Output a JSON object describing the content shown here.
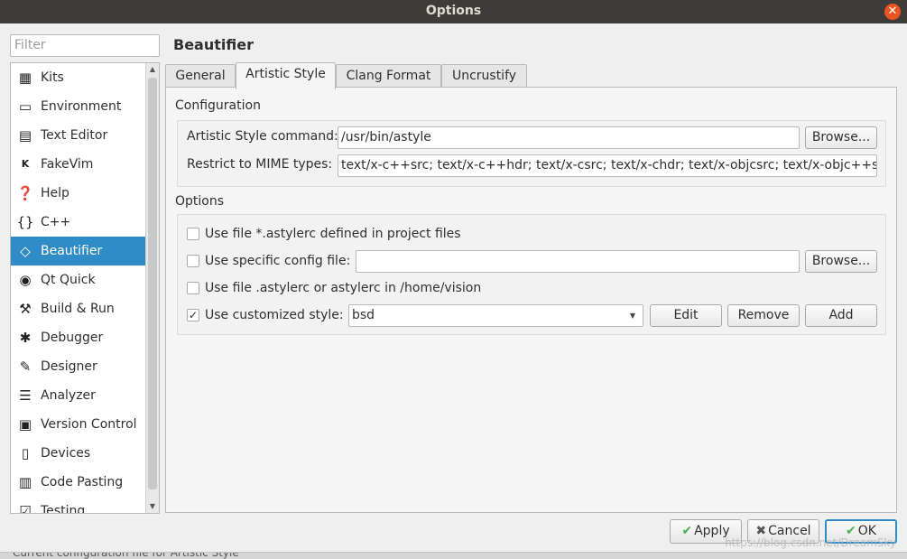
{
  "window": {
    "title": "Options"
  },
  "filter": {
    "placeholder": "Filter"
  },
  "categories": [
    {
      "label": "Kits",
      "icon": "kits-icon"
    },
    {
      "label": "Environment",
      "icon": "monitor-icon"
    },
    {
      "label": "Text Editor",
      "icon": "text-editor-icon"
    },
    {
      "label": "FakeVim",
      "icon": "fakevim-icon"
    },
    {
      "label": "Help",
      "icon": "help-icon"
    },
    {
      "label": "C++",
      "icon": "braces-icon"
    },
    {
      "label": "Beautifier",
      "icon": "diamond-icon"
    },
    {
      "label": "Qt Quick",
      "icon": "qtquick-icon"
    },
    {
      "label": "Build & Run",
      "icon": "hammer-icon"
    },
    {
      "label": "Debugger",
      "icon": "bug-icon"
    },
    {
      "label": "Designer",
      "icon": "pencil-icon"
    },
    {
      "label": "Analyzer",
      "icon": "analyzer-icon"
    },
    {
      "label": "Version Control",
      "icon": "version-control-icon"
    },
    {
      "label": "Devices",
      "icon": "devices-icon"
    },
    {
      "label": "Code Pasting",
      "icon": "clipboard-icon"
    },
    {
      "label": "Testing",
      "icon": "testing-icon"
    }
  ],
  "page": {
    "title": "Beautifier"
  },
  "tabs": [
    "General",
    "Artistic Style",
    "Clang Format",
    "Uncrustify"
  ],
  "configuration": {
    "heading": "Configuration",
    "command_label": "Artistic Style command:",
    "command_value": "/usr/bin/astyle",
    "browse_label": "Browse...",
    "mime_label": "Restrict to MIME types:",
    "mime_value": "text/x-c++src; text/x-c++hdr; text/x-csrc; text/x-chdr; text/x-objcsrc; text/x-objc++src"
  },
  "options": {
    "heading": "Options",
    "use_project_file": {
      "label": "Use file *.astylerc defined in project files",
      "checked": false
    },
    "use_specific_config": {
      "label": "Use specific config file:",
      "checked": false,
      "value": "",
      "browse_label": "Browse..."
    },
    "use_home_file": {
      "label": "Use file .astylerc or astylerc in /home/vision",
      "checked": false
    },
    "use_customized_style": {
      "label": "Use customized style:",
      "checked": true,
      "selected": "bsd",
      "edit_label": "Edit",
      "remove_label": "Remove",
      "add_label": "Add"
    }
  },
  "dialog_buttons": {
    "apply": "Apply",
    "cancel": "Cancel",
    "ok": "OK"
  },
  "status": {
    "text": "Current configuration file for Artistic Style"
  },
  "watermark": "https://blog.csdn.net/DreamSky",
  "colors": {
    "selection": "#308cc6",
    "titlebar": "#3d3c38",
    "close": "#e95420"
  }
}
